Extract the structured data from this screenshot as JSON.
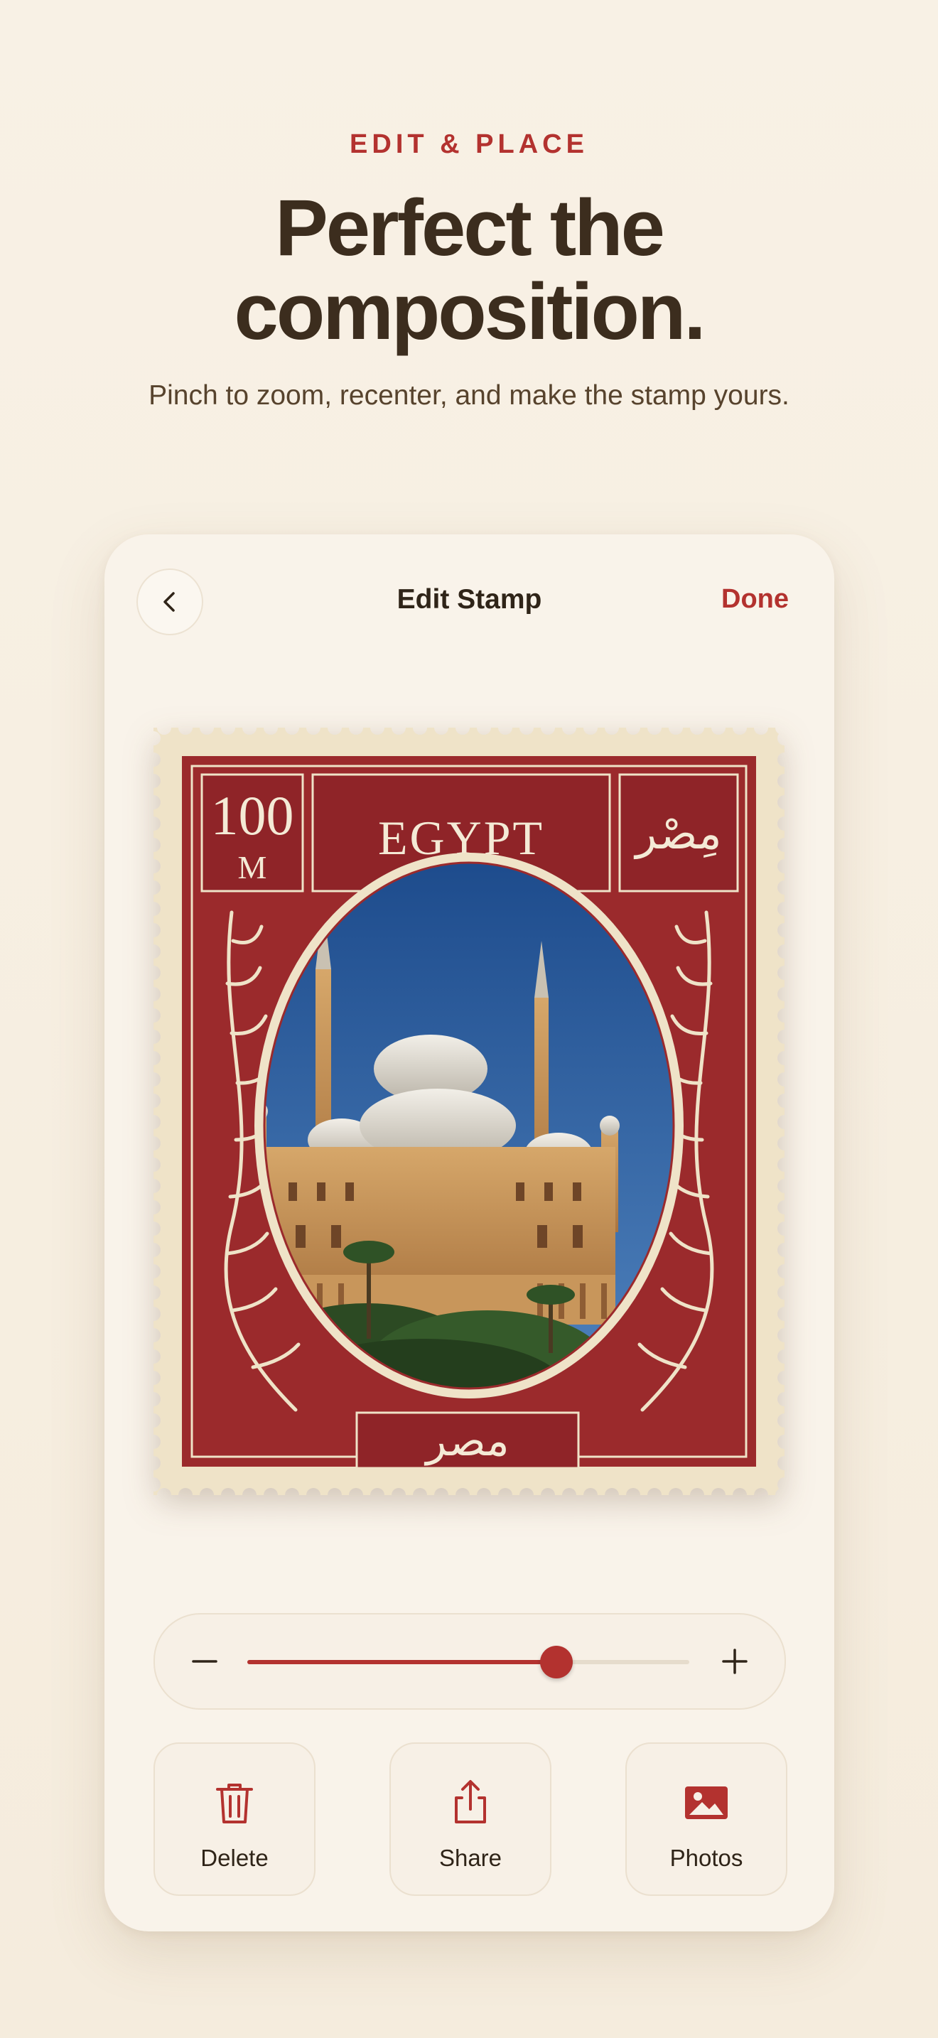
{
  "header": {
    "eyebrow": "EDIT & PLACE",
    "headline_line1": "Perfect the",
    "headline_line2": "composition.",
    "subhead": "Pinch to zoom, recenter, and make the stamp yours."
  },
  "editor": {
    "title": "Edit Stamp",
    "done_label": "Done",
    "back_icon": "chevron-left-icon"
  },
  "stamp": {
    "denomination": "100",
    "denomination_unit": "M",
    "country": "EGYPT",
    "arabic_corner": "مِصْر",
    "arabic_bottom": "مصر",
    "frame_color": "#9b2a2c",
    "paper_color": "#efe3c8"
  },
  "zoom": {
    "level": 0.7,
    "minus_icon": "minus-icon",
    "plus_icon": "plus-icon"
  },
  "actions": [
    {
      "label": "Delete",
      "icon": "trash-icon"
    },
    {
      "label": "Share",
      "icon": "share-icon"
    },
    {
      "label": "Photos",
      "icon": "photos-icon"
    }
  ],
  "colors": {
    "accent": "#b3322f",
    "text_dark": "#3c2d1e",
    "background": "#f8f1e5"
  }
}
